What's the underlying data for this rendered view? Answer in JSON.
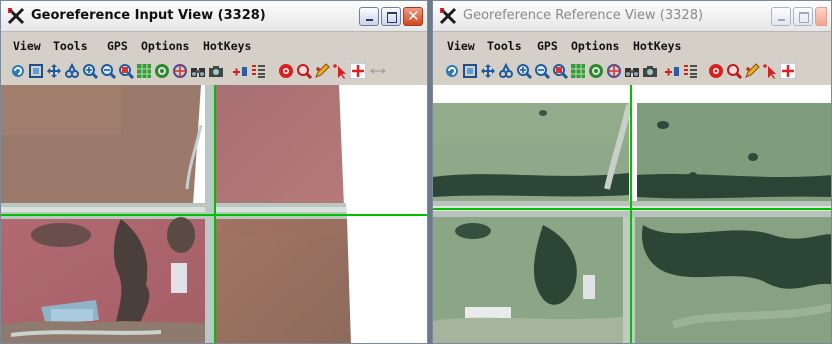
{
  "input_window": {
    "title": "Georeference Input View (3328)",
    "menu": [
      "View",
      "Tools",
      "GPS",
      "Options",
      "HotKeys"
    ]
  },
  "reference_window": {
    "title": "Georeference Reference View (3328)",
    "menu": [
      "View",
      "Tools",
      "GPS",
      "Options",
      "HotKeys"
    ]
  },
  "toolbar_icons": [
    "redraw-icon",
    "full-view-icon",
    "pan-icon",
    "zoom-box-icon",
    "zoom-in-icon",
    "zoom-out-icon",
    "zoom-extent-icon",
    "zoom-layer-icon",
    "move-icon",
    "locate-icon",
    "find-icon",
    "capture-icon",
    "add-point-icon",
    "point-list-icon",
    "delete-point-icon",
    "zoom-point-icon",
    "edit-point-icon",
    "select-point-icon",
    "crosshair-icon",
    "line-tool-icon"
  ],
  "colors": {
    "crosshair": "#00c000",
    "title_active": "#111111",
    "title_inactive": "#8a8a8a",
    "close_button": "#d2461f"
  }
}
